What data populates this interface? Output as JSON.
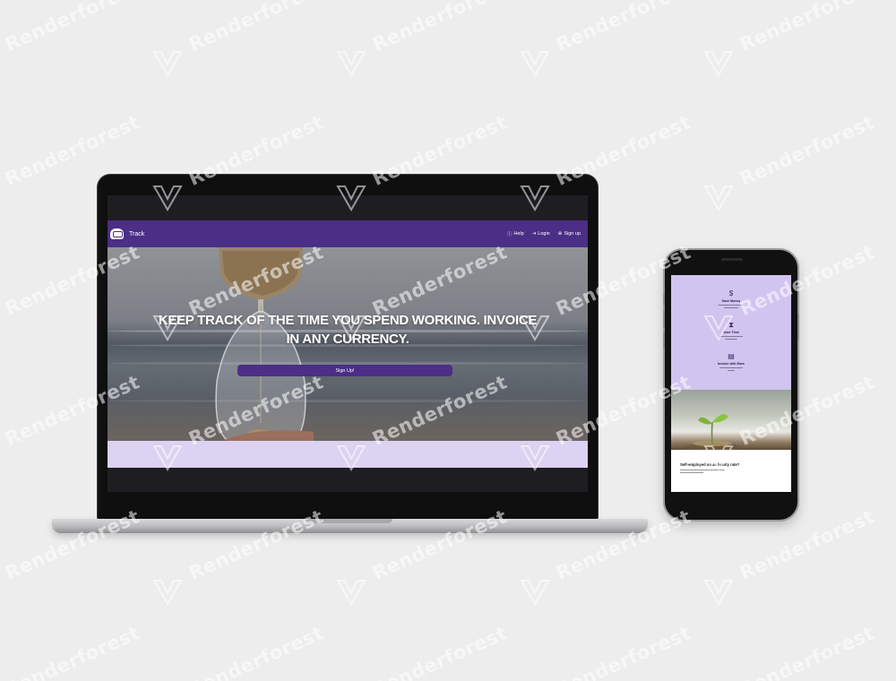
{
  "laptop": {
    "navbar": {
      "brand_name": "Track",
      "links": [
        {
          "icon": "help-icon",
          "label": "Help"
        },
        {
          "icon": "login-icon",
          "label": "Login"
        },
        {
          "icon": "signup-icon",
          "label": "Sign up"
        }
      ]
    },
    "hero": {
      "title_line1": "KEEP TRACK OF THE TIME YOU SPEND WORKING. INVOICE",
      "title_line2": "IN ANY CURRENCY.",
      "cta_label": "Sign Up!"
    }
  },
  "phone": {
    "features": [
      {
        "icon": "dollar-icon",
        "title": "Save Money"
      },
      {
        "icon": "hourglass-icon",
        "title": "Save Time"
      },
      {
        "icon": "document-icon",
        "title": "Invoice with Ease"
      }
    ],
    "section_heading": "Self-employed on an hourly rate?"
  },
  "watermark": {
    "text": "Renderforest"
  },
  "colors": {
    "brand_purple": "#4b2e85",
    "lavender": "#dcd2f1",
    "feature_bg": "#d1c4ef"
  }
}
